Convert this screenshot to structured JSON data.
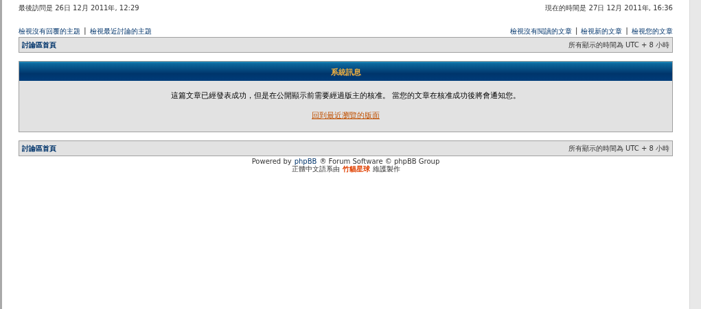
{
  "header": {
    "last_visit": "最後訪問是 26日 12月 2011年, 12:29",
    "current_time": "現在的時間是 27日 12月 2011年, 16:36"
  },
  "links_left": [
    {
      "kind": "link",
      "text": "檢視沒有回覆的主題"
    },
    {
      "kind": "separator",
      "text": "|"
    },
    {
      "kind": "link",
      "text": "檢視最近討論的主題"
    }
  ],
  "links_right": [
    {
      "kind": "link",
      "text": "檢視沒有閱讀的文章"
    },
    {
      "kind": "separator",
      "text": "|"
    },
    {
      "kind": "link",
      "text": "檢視新的文章"
    },
    {
      "kind": "separator",
      "text": "|"
    },
    {
      "kind": "link",
      "text": "檢視您的文章"
    }
  ],
  "nav_top": {
    "home": "討論區首頁",
    "timezone": "所有顯示的時間為 UTC + 8 小時"
  },
  "message": {
    "title": "系統訊息",
    "text": "這篇文章已經發表成功，但是在公開顯示前需要經過版主的核准。 當您的文章在核准成功後將會通知您。",
    "link": "回到最近瀏覽的版面"
  },
  "nav_bottom": {
    "home": "討論區首頁",
    "timezone": "所有顯示的時間為 UTC + 8 小時"
  },
  "footer": [
    [
      {
        "kind": "text",
        "text": "Powered by"
      },
      {
        "kind": "link",
        "text": "phpBB"
      },
      {
        "kind": "text",
        "text": "® Forum Software © phpBB Group"
      }
    ],
    [
      {
        "kind": "text",
        "text": "正體中文語系由"
      },
      {
        "kind": "strong-link",
        "text": "竹貓星球"
      },
      {
        "kind": "text",
        "text": "維護製作"
      }
    ]
  ]
}
